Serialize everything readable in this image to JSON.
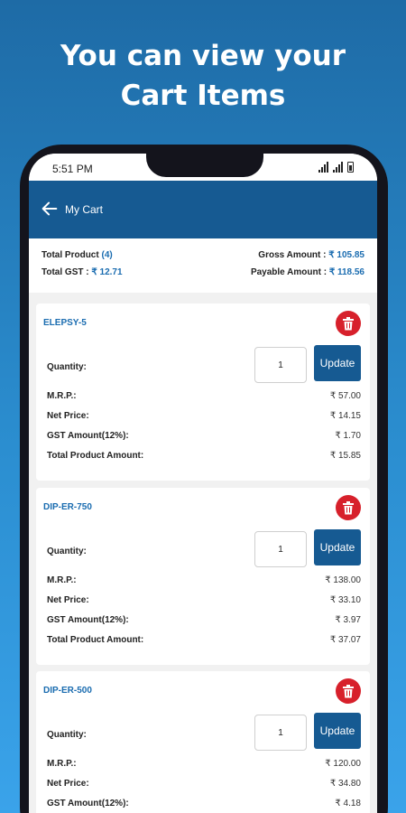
{
  "headline": {
    "line1": "You can view your",
    "line2": "Cart Items"
  },
  "statusbar": {
    "time": "5:51 PM"
  },
  "appbar": {
    "title": "My Cart"
  },
  "summary": {
    "total_product_label": "Total Product",
    "total_product_value": "(4)",
    "gross_amount_label": "Gross Amount :",
    "gross_amount_value": "₹ 105.85",
    "total_gst_label": "Total GST :",
    "total_gst_value": "₹ 12.71",
    "payable_amount_label": "Payable Amount :",
    "payable_amount_value": "₹ 118.56"
  },
  "labels": {
    "quantity": "Quantity:",
    "mrp": "M.R.P.:",
    "net_price": "Net Price:",
    "gst_amount": "GST Amount(12%):",
    "total_product_amount": "Total Product Amount:",
    "update": "Update"
  },
  "items": [
    {
      "name": "ELEPSY-5",
      "qty": "1",
      "mrp": "₹ 57.00",
      "net_price": "₹ 14.15",
      "gst": "₹ 1.70",
      "total": "₹ 15.85"
    },
    {
      "name": "DIP-ER-750",
      "qty": "1",
      "mrp": "₹ 138.00",
      "net_price": "₹ 33.10",
      "gst": "₹ 3.97",
      "total": "₹ 37.07"
    },
    {
      "name": "DIP-ER-500",
      "qty": "1",
      "mrp": "₹ 120.00",
      "net_price": "₹ 34.80",
      "gst": "₹ 4.18",
      "total": ""
    }
  ],
  "colors": {
    "primary": "#165a92",
    "accent_text": "#1a6cb0",
    "delete": "#d7202b"
  },
  "icons": {
    "back": "arrow-left-icon",
    "delete": "trash-icon"
  }
}
